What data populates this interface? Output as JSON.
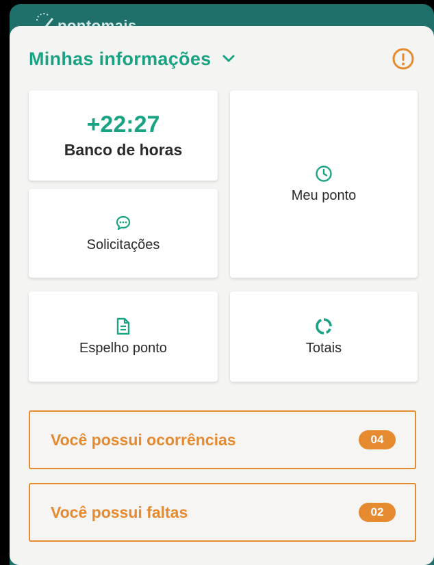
{
  "app": {
    "logo_text": "pontomais"
  },
  "header": {
    "title": "Minhas informações"
  },
  "cards": {
    "balance": {
      "value": "+22:27",
      "label": "Banco de horas"
    },
    "requests": {
      "label": "Solicitações",
      "icon": "chat-bubble-icon"
    },
    "my_clock": {
      "label": "Meu ponto",
      "icon": "clock-icon"
    },
    "timesheet": {
      "label": "Espelho ponto",
      "icon": "document-icon"
    },
    "totals": {
      "label": "Totais",
      "icon": "circle-progress-icon"
    }
  },
  "notices": [
    {
      "text": "Você possui ocorrências",
      "badge": "04"
    },
    {
      "text": "Você possui faltas",
      "badge": "02"
    }
  ],
  "colors": {
    "accent": "#1aa383",
    "warning": "#e58a2f",
    "header_bar": "#1f6f6a",
    "panel_bg": "#f4f4f2"
  }
}
